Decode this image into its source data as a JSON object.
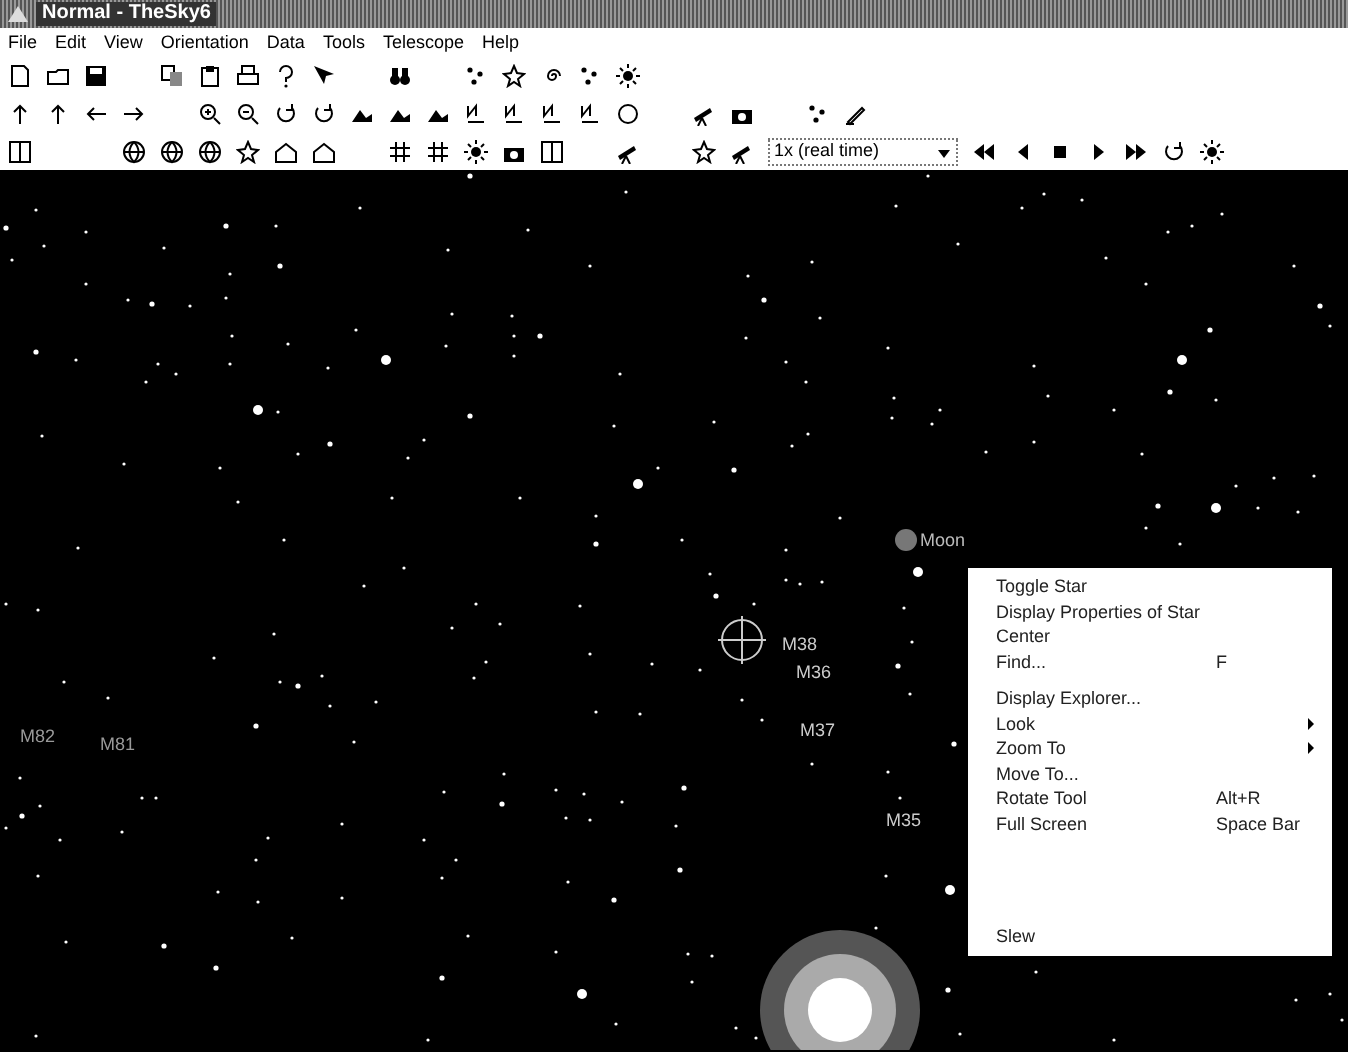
{
  "window": {
    "title": "Normal - TheSky6"
  },
  "menu_bar": [
    "File",
    "Edit",
    "View",
    "Orientation",
    "Data",
    "Tools",
    "Telescope",
    "Help"
  ],
  "time_step": {
    "value": "1x (real time)"
  },
  "sky_labels": [
    {
      "text": "Moon",
      "kind": "moon"
    },
    {
      "text": "M38",
      "kind": "cluster"
    },
    {
      "text": "M36",
      "kind": "cluster"
    },
    {
      "text": "M37",
      "kind": "cluster"
    },
    {
      "text": "M35",
      "kind": "cluster"
    },
    {
      "text": "M82",
      "kind": "galaxy"
    },
    {
      "text": "M81",
      "kind": "galaxy"
    }
  ],
  "context_menu": {
    "groups": [
      [
        {
          "label": "Toggle Star"
        },
        {
          "label": "Display Properties of Star"
        },
        {
          "label": "Center"
        },
        {
          "label": "Find...",
          "shortcut": "F"
        }
      ],
      [
        {
          "label": "Display Explorer..."
        },
        {
          "label": "Look",
          "submenu": true
        },
        {
          "label": "Zoom To",
          "submenu": true
        },
        {
          "label": "Move To..."
        },
        {
          "label": "Rotate Tool",
          "shortcut": "Alt+R"
        },
        {
          "label": "Full Screen",
          "shortcut": "Space Bar"
        }
      ],
      [
        {
          "label": "Slew"
        }
      ]
    ]
  }
}
